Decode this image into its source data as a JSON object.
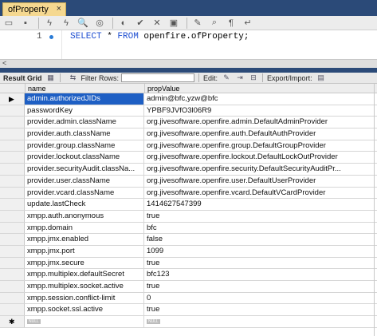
{
  "tab": {
    "title": "ofProperty",
    "close": "×"
  },
  "editor": {
    "line_number": "1",
    "sql_select": "SELECT",
    "sql_star": " * ",
    "sql_from": "FROM",
    "sql_table": " openfire.ofProperty;"
  },
  "result_toolbar": {
    "result_grid": "Result Grid",
    "filter_rows": "Filter Rows:",
    "edit": "Edit:",
    "export_import": "Export/Import:"
  },
  "grid": {
    "columns": [
      "name",
      "propValue"
    ],
    "rows": [
      {
        "name": "admin.authorizedJIDs",
        "value": "admin@bfc,yzw@bfc"
      },
      {
        "name": "passwordKey",
        "value": "YPBF9JVfO3l06R9"
      },
      {
        "name": "provider.admin.className",
        "value": "org.jivesoftware.openfire.admin.DefaultAdminProvider"
      },
      {
        "name": "provider.auth.className",
        "value": "org.jivesoftware.openfire.auth.DefaultAuthProvider"
      },
      {
        "name": "provider.group.className",
        "value": "org.jivesoftware.openfire.group.DefaultGroupProvider"
      },
      {
        "name": "provider.lockout.className",
        "value": "org.jivesoftware.openfire.lockout.DefaultLockOutProvider"
      },
      {
        "name": "provider.securityAudit.classNa...",
        "value": "org.jivesoftware.openfire.security.DefaultSecurityAuditPr..."
      },
      {
        "name": "provider.user.className",
        "value": "org.jivesoftware.openfire.user.DefaultUserProvider"
      },
      {
        "name": "provider.vcard.className",
        "value": "org.jivesoftware.openfire.vcard.DefaultVCardProvider"
      },
      {
        "name": "update.lastCheck",
        "value": "1414627547399"
      },
      {
        "name": "xmpp.auth.anonymous",
        "value": "true"
      },
      {
        "name": "xmpp.domain",
        "value": "bfc"
      },
      {
        "name": "xmpp.jmx.enabled",
        "value": "false"
      },
      {
        "name": "xmpp.jmx.port",
        "value": "1099"
      },
      {
        "name": "xmpp.jmx.secure",
        "value": "true"
      },
      {
        "name": "xmpp.multiplex.defaultSecret",
        "value": "bfc123"
      },
      {
        "name": "xmpp.multiplex.socket.active",
        "value": "true"
      },
      {
        "name": "xmpp.session.conflict-limit",
        "value": "0"
      },
      {
        "name": "xmpp.socket.ssl.active",
        "value": "true"
      }
    ],
    "null_label": "NULL",
    "current_row_marker": "▶",
    "new_row_marker": "✱"
  }
}
